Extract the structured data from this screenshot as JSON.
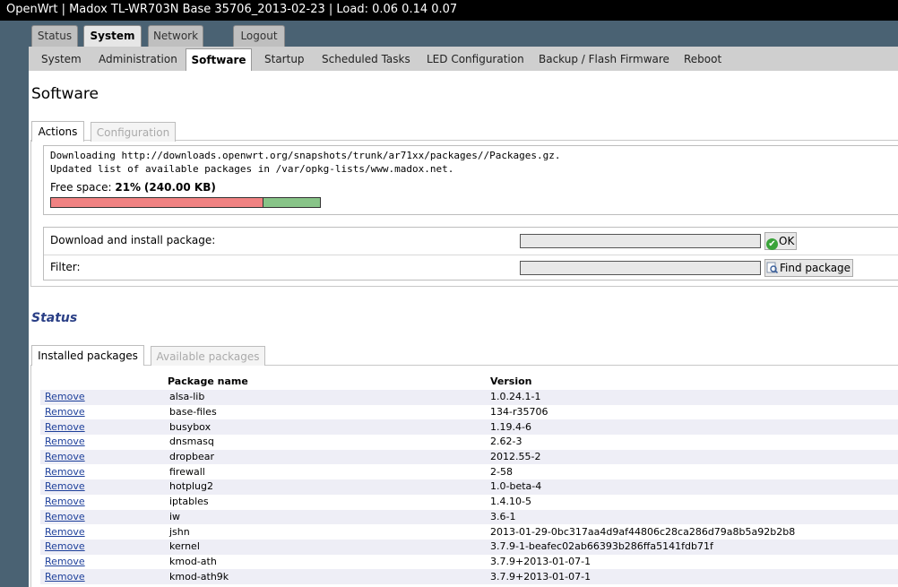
{
  "header": {
    "title": "OpenWrt | Madox TL-WR703N Base 35706_2013-02-23 | Load: 0.06 0.14 0.07"
  },
  "main_tabs": [
    "Status",
    "System",
    "Network",
    "Logout"
  ],
  "sub_tabs": [
    "System",
    "Administration",
    "Software",
    "Startup",
    "Scheduled Tasks",
    "LED Configuration",
    "Backup / Flash Firmware",
    "Reboot"
  ],
  "page": {
    "title": "Software"
  },
  "software_tabs": [
    "Actions",
    "Configuration"
  ],
  "log": [
    "Downloading http://downloads.openwrt.org/snapshots/trunk/ar71xx/packages//Packages.gz.",
    "Updated list of available packages in /var/opkg-lists/www.madox.net."
  ],
  "free_space": {
    "label": "Free space:",
    "percent_text": "21%",
    "size_text": "(240.00 KB)",
    "used_fraction": 0.79
  },
  "form": {
    "download_label": "Download and install package:",
    "download_value": "",
    "ok_label": "OK",
    "filter_label": "Filter:",
    "filter_value": "",
    "find_label": "Find package"
  },
  "status": {
    "title": "Status"
  },
  "package_tabs": [
    "Installed packages",
    "Available packages"
  ],
  "table": {
    "headers": [
      "Package name",
      "Version"
    ],
    "remove_label": "Remove",
    "rows": [
      {
        "name": "alsa-lib",
        "version": "1.0.24.1-1"
      },
      {
        "name": "base-files",
        "version": "134-r35706"
      },
      {
        "name": "busybox",
        "version": "1.19.4-6"
      },
      {
        "name": "dnsmasq",
        "version": "2.62-3"
      },
      {
        "name": "dropbear",
        "version": "2012.55-2"
      },
      {
        "name": "firewall",
        "version": "2-58"
      },
      {
        "name": "hotplug2",
        "version": "1.0-beta-4"
      },
      {
        "name": "iptables",
        "version": "1.4.10-5"
      },
      {
        "name": "iw",
        "version": "3.6-1"
      },
      {
        "name": "jshn",
        "version": "2013-01-29-0bc317aa4d9af44806c28ca286d79a8b5a92b2b8"
      },
      {
        "name": "kernel",
        "version": "3.7.9-1-beafec02ab66393b286ffa5141fdb71f"
      },
      {
        "name": "kmod-ath",
        "version": "3.7.9+2013-01-07-1"
      },
      {
        "name": "kmod-ath9k",
        "version": "3.7.9+2013-01-07-1"
      }
    ]
  },
  "colors": {
    "page_bg": "#4a6273",
    "free_space_used": "#f08282",
    "free_space_free": "#88c488",
    "status_title": "#2a3f86",
    "link": "#1d3f9a"
  }
}
